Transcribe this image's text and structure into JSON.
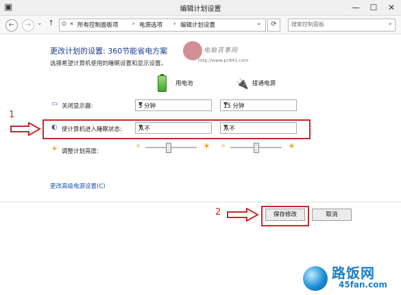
{
  "window": {
    "title": "编辑计划设置"
  },
  "nav": {
    "back": "←",
    "forward": "→",
    "up": "↑"
  },
  "address": {
    "prefix": "«",
    "crumbs": [
      "所有控制面板项",
      "电源选项",
      "编辑计划设置"
    ],
    "sep": "›",
    "dropdown": "⌄"
  },
  "search": {
    "placeholder": "搜索控制面板"
  },
  "heading": "更改计划的设置: 360节能省电方案",
  "subheading": "选择希望计算机使用的睡眠设置和显示设置。",
  "watermark": {
    "text": "电脑百事网",
    "url": "http://www.pc841.com"
  },
  "columns": {
    "battery": "用电池",
    "plugged": "接通电源"
  },
  "rows": {
    "display_off": {
      "label": "关闭显示器:",
      "battery_value": "5 分钟",
      "plugged_value": "15 分钟"
    },
    "sleep": {
      "label": "使计算机进入睡眠状态:",
      "battery_value": "从不",
      "plugged_value": "从不"
    },
    "brightness": {
      "label": "调整计划亮度:",
      "battery_level": 0.45,
      "plugged_level": 0.5
    }
  },
  "annotations": {
    "one": "1",
    "two": "2"
  },
  "advanced_link": "更改高级电源设置(C)",
  "buttons": {
    "save": "保存修改",
    "cancel": "取消"
  },
  "logo": {
    "name": "路饭网",
    "url": "45fan.com"
  },
  "colors": {
    "accent": "#1e3c8c",
    "link": "#1a52b0",
    "annotation_red": "#c62828"
  }
}
